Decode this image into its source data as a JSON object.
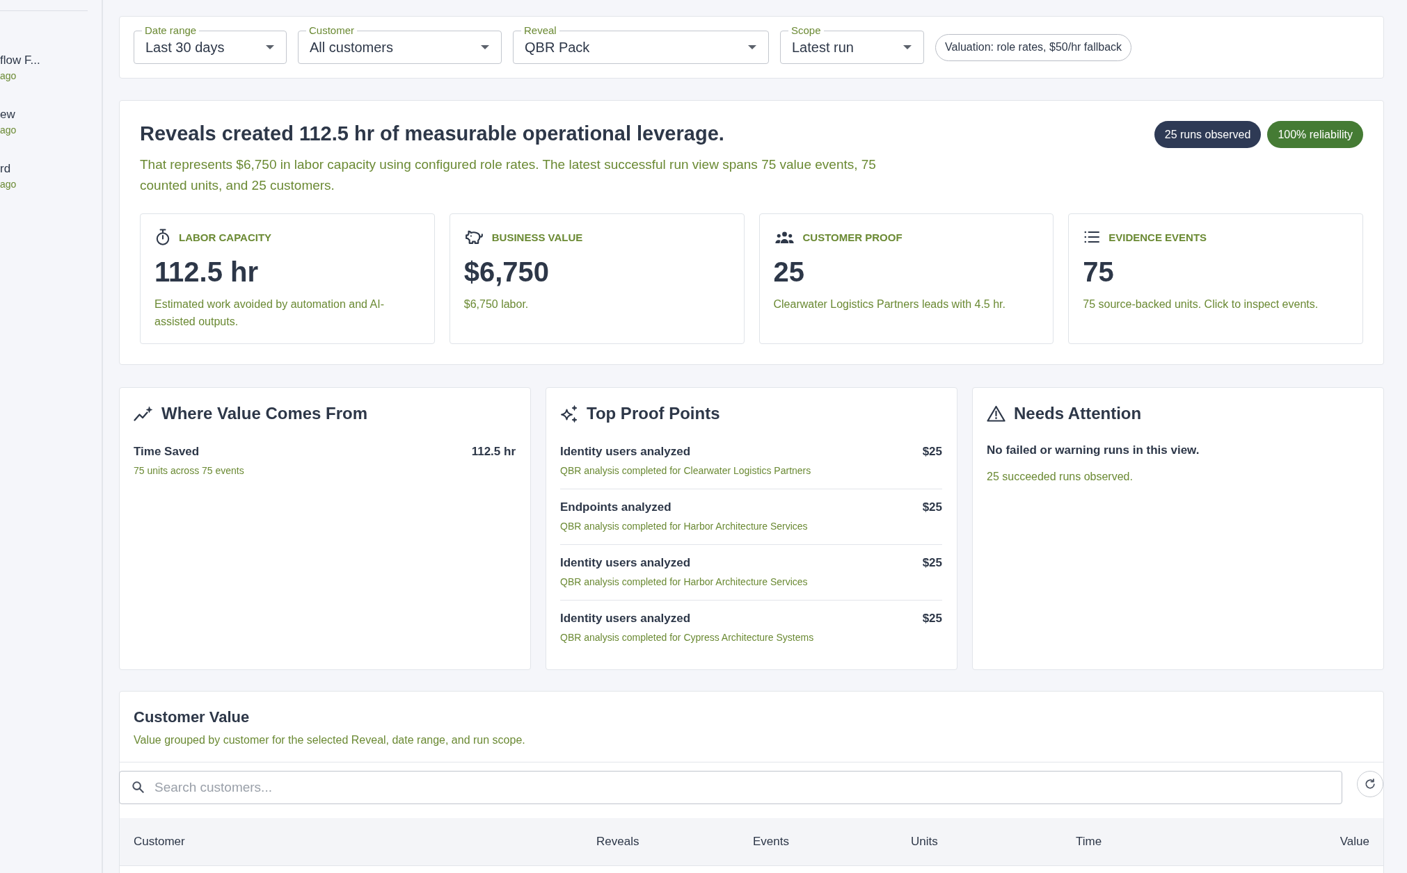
{
  "sidebar": {
    "items": [
      {
        "title": "flow F...",
        "time": "ago"
      },
      {
        "title": "ew",
        "time": "ago"
      },
      {
        "title": "rd",
        "time": "ago"
      }
    ]
  },
  "filters": {
    "fields": [
      {
        "label": "Date range",
        "value": "Last 30 days"
      },
      {
        "label": "Customer",
        "value": "All customers"
      },
      {
        "label": "Reveal",
        "value": "QBR Pack"
      },
      {
        "label": "Scope",
        "value": "Latest run"
      }
    ],
    "valuation": "Valuation: role rates, $50/hr fallback"
  },
  "summary": {
    "headline": "Reveals created 112.5 hr of measurable operational leverage.",
    "description": "That represents $6,750 in labor capacity using configured role rates. The latest successful run view spans 75 value events, 75 counted units, and 25 customers.",
    "badges": [
      {
        "text": "25 runs observed",
        "color": "#2e3a55"
      },
      {
        "text": "100% reliability",
        "color": "#457b34"
      }
    ],
    "metrics": [
      {
        "label": "LABOR CAPACITY",
        "value": "112.5 hr",
        "description": "Estimated work avoided by automation and AI-assisted outputs."
      },
      {
        "label": "BUSINESS VALUE",
        "value": "$6,750",
        "description": "$6,750 labor."
      },
      {
        "label": "CUSTOMER PROOF",
        "value": "25",
        "description": "Clearwater Logistics Partners leads with 4.5 hr."
      },
      {
        "label": "EVIDENCE EVENTS",
        "value": "75",
        "description": "75 source-backed units. Click to inspect events."
      }
    ]
  },
  "value_sources": {
    "title": "Where Value Comes From",
    "items": [
      {
        "name": "Time Saved",
        "value": "112.5 hr",
        "detail": "75 units across 75 events"
      }
    ]
  },
  "proof_points": {
    "title": "Top Proof Points",
    "items": [
      {
        "name": "Identity users analyzed",
        "value": "$25",
        "detail": "QBR analysis completed for Clearwater Logistics Partners"
      },
      {
        "name": "Endpoints analyzed",
        "value": "$25",
        "detail": "QBR analysis completed for Harbor Architecture Services"
      },
      {
        "name": "Identity users analyzed",
        "value": "$25",
        "detail": "QBR analysis completed for Harbor Architecture Services"
      },
      {
        "name": "Identity users analyzed",
        "value": "$25",
        "detail": "QBR analysis completed for Cypress Architecture Systems"
      }
    ]
  },
  "needs_attention": {
    "title": "Needs Attention",
    "message": "No failed or warning runs in this view.",
    "detail": "25 succeeded runs observed."
  },
  "customer_value": {
    "title": "Customer Value",
    "description": "Value grouped by customer for the selected Reveal, date range, and run scope.",
    "search": {
      "placeholder": "Search customers..."
    },
    "table": {
      "columns": [
        "Customer",
        "Reveals",
        "Events",
        "Units",
        "Time",
        "Value"
      ]
    }
  }
}
